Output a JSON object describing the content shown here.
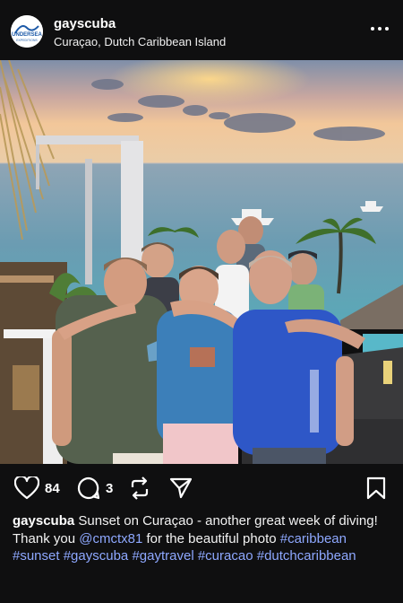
{
  "post": {
    "username": "gayscuba",
    "location": "Curaçao, Dutch Caribbean Island",
    "avatar_logo_text": "UNDERSEA EXPEDITIONS"
  },
  "actions": {
    "likes": "84",
    "comments": "3"
  },
  "caption": {
    "username": "gayscuba",
    "text_part1": "Sunset on Curaçao - another great week of diving! Thank you",
    "mention": "@cmctx81",
    "text_part2": "for the beautiful photo",
    "hashtags": [
      "#caribbean",
      "#sunset",
      "#gayscuba",
      "#gaytravel",
      "#curacao",
      "#dutchcaribbean"
    ]
  },
  "icons": [
    "more-icon",
    "heart-icon",
    "comment-icon",
    "repost-icon",
    "share-icon",
    "bookmark-icon"
  ]
}
